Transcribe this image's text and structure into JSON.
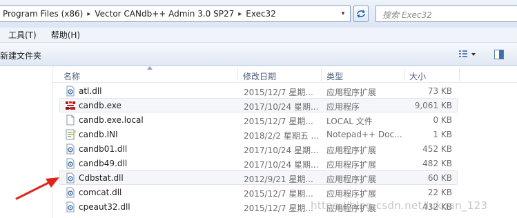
{
  "address": {
    "crumbs": [
      "Program Files (x86)",
      "Vector CANdb++ Admin 3.0 SP27",
      "Exec32"
    ],
    "separator": "▸",
    "dropdown": "▾"
  },
  "search": {
    "placeholder": "搜索 Exec32"
  },
  "menu": [
    "工具(T)",
    "帮助(H)"
  ],
  "toolbar": {
    "new_folder": "新建文件夹"
  },
  "columns": {
    "name": "名称",
    "date": "修改日期",
    "type": "类型",
    "size": "大小"
  },
  "files": [
    {
      "name": "atl.dll",
      "date": "2015/12/7 星期...",
      "type": "应用程序扩展",
      "size": "73 KB",
      "icon": "dll-icon"
    },
    {
      "name": "candb.exe",
      "date": "2017/10/24 星期...",
      "type": "应用程序",
      "size": "9,061 KB",
      "icon": "exe-icon"
    },
    {
      "name": "candb.exe.local",
      "date": "2015/12/7 星期...",
      "type": "LOCAL 文件",
      "size": "0 KB",
      "icon": "file-icon"
    },
    {
      "name": "candb.INI",
      "date": "2018/2/2 星期五 ...",
      "type": "Notepad++ Doc...",
      "size": "1 KB",
      "icon": "ini-icon"
    },
    {
      "name": "candb01.dll",
      "date": "2017/10/24 星期...",
      "type": "应用程序扩展",
      "size": "452 KB",
      "icon": "dll-icon"
    },
    {
      "name": "candb49.dll",
      "date": "2017/10/24 星期...",
      "type": "应用程序扩展",
      "size": "482 KB",
      "icon": "dll-icon"
    },
    {
      "name": "Cdbstat.dll",
      "date": "2012/9/21 星期...",
      "type": "应用程序扩展",
      "size": "60 KB",
      "icon": "dll-icon"
    },
    {
      "name": "comcat.dll",
      "date": "2015/12/7 星期...",
      "type": "应用程序扩展",
      "size": "22 KB",
      "icon": "dll-icon"
    },
    {
      "name": "cpeaut32.dll",
      "date": "2015/12/7 星期...",
      "type": "应用程序扩展",
      "size": "432 KB",
      "icon": "dll-icon"
    }
  ],
  "highlighted_rows": [
    1,
    6
  ],
  "watermark": "https://blog.csdn.net/lukuan_123",
  "colors": {
    "arrow": "#e0241c",
    "header_text": "#4c607a",
    "accent": "#3c7fb1"
  }
}
